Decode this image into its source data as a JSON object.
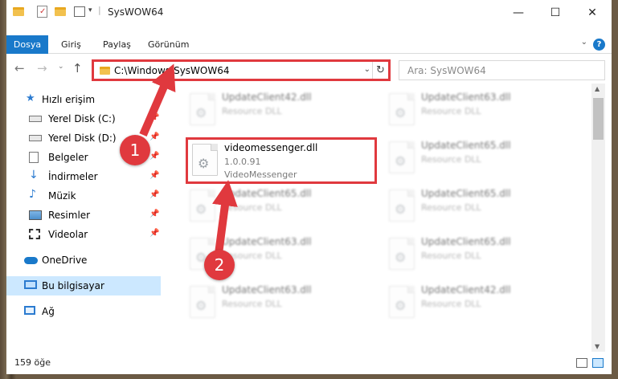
{
  "window": {
    "title": "SysWOW64",
    "controls": {
      "minimize": "—",
      "maximize": "☐",
      "close": "✕"
    }
  },
  "ribbon": {
    "tabs": [
      {
        "label": "Dosya"
      },
      {
        "label": "Giriş"
      },
      {
        "label": "Paylaş"
      },
      {
        "label": "Görünüm"
      }
    ],
    "help": "?"
  },
  "nav": {
    "address": "C:\\Windows\\SysWOW64",
    "search_placeholder": "Ara: SysWOW64"
  },
  "sidebar": {
    "items": [
      {
        "label": "Hızlı erişim",
        "icon": "star-icon"
      },
      {
        "label": "Yerel Disk (C:)",
        "icon": "drive-icon",
        "pinned": true
      },
      {
        "label": "Yerel Disk (D:)",
        "icon": "drive-icon",
        "pinned": true
      },
      {
        "label": "Belgeler",
        "icon": "documents-icon",
        "pinned": true
      },
      {
        "label": "İndirmeler",
        "icon": "download-icon",
        "pinned": true
      },
      {
        "label": "Müzik",
        "icon": "music-icon",
        "pinned": true
      },
      {
        "label": "Resimler",
        "icon": "pictures-icon",
        "pinned": true
      },
      {
        "label": "Videolar",
        "icon": "videos-icon",
        "pinned": true
      },
      {
        "label": "OneDrive",
        "icon": "cloud-icon"
      },
      {
        "label": "Bu bilgisayar",
        "icon": "computer-icon",
        "selected": true
      },
      {
        "label": "Ağ",
        "icon": "network-icon"
      }
    ]
  },
  "files": [
    {
      "name": "UpdateClient42.dll",
      "type": "Resource DLL"
    },
    {
      "name": "UpdateClient63.dll",
      "type": "Resource DLL"
    },
    {
      "name": "UpdateClient65.dll",
      "type": "Resource DLL"
    },
    {
      "name": "UpdateClient65.dll",
      "type": "Resource DLL"
    },
    {
      "name": "UpdateClient65.dll",
      "type": "Resource DLL"
    },
    {
      "name": "UpdateClient63.dll",
      "type": "Resource DLL"
    },
    {
      "name": "UpdateClient65.dll",
      "type": "Resource DLL"
    },
    {
      "name": "UpdateClient63.dll",
      "type": "Resource DLL"
    },
    {
      "name": "UpdateClient42.dll",
      "type": "Resource DLL"
    }
  ],
  "selected_file": {
    "name": "videomessenger.dll",
    "version": "1.0.0.91",
    "description": "VideoMessenger"
  },
  "status": {
    "count": "159 öğe"
  },
  "annotations": {
    "step1": "1",
    "step2": "2",
    "color": "#e0393e"
  },
  "colors": {
    "accent": "#1979ca",
    "selection": "#cce8ff",
    "highlight": "#e0393e"
  }
}
